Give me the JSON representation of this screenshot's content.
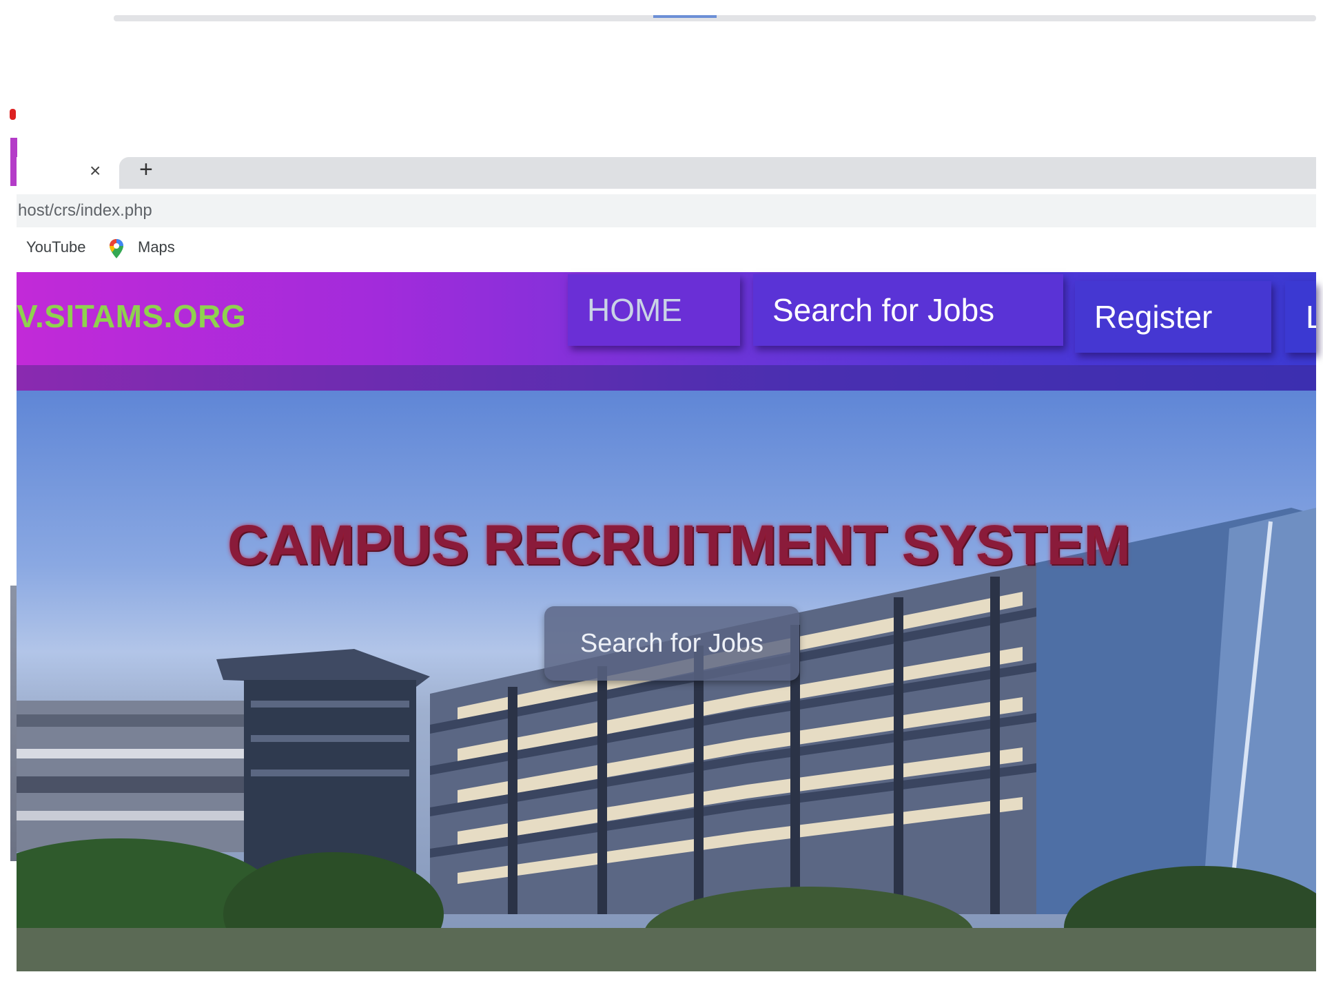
{
  "browser": {
    "tab_close_icon": "×",
    "new_tab_icon": "+",
    "address": "host/crs/index.php",
    "bookmarks": [
      {
        "label": "YouTube",
        "icon": "youtube-icon"
      },
      {
        "label": "Maps",
        "icon": "maps-pin-icon"
      }
    ]
  },
  "site": {
    "brand": "V.SITAMS.ORG",
    "nav": [
      {
        "label": "HOME"
      },
      {
        "label": "Search for Jobs"
      },
      {
        "label": "Register"
      },
      {
        "label": "L"
      }
    ],
    "hero_title": "CAMPUS RECRUITMENT SYSTEM",
    "hero_button": "Search for Jobs"
  },
  "colors": {
    "navbar_start": "#c22ad8",
    "navbar_end": "#3c3ad2",
    "brand_text": "#8fd14f",
    "hero_title": "#8a1b3a"
  }
}
